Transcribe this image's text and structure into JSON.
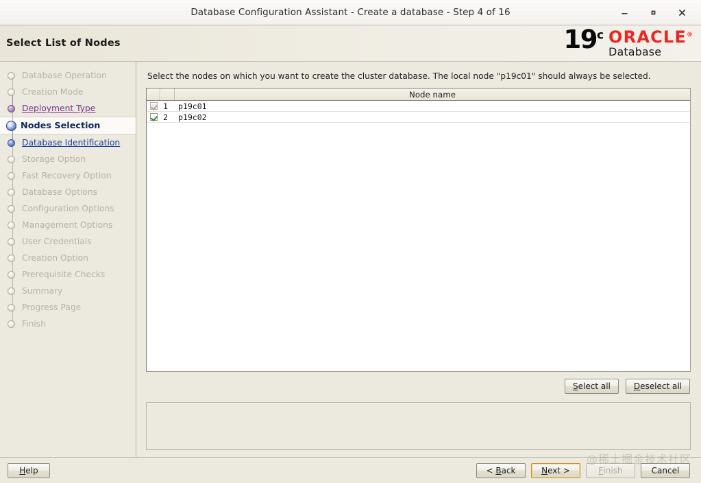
{
  "window": {
    "title": "Database Configuration Assistant - Create a database - Step 4 of 16",
    "controls": {
      "minimize": "minimize-icon",
      "maximize": "maximize-icon",
      "close": "close-icon"
    }
  },
  "header": {
    "page_title": "Select List of Nodes",
    "brand": {
      "version": "19",
      "version_sup": "c",
      "product": "ORACLE",
      "product_sup": "®",
      "subtitle": "Database",
      "oracle_red": "#ea2724"
    }
  },
  "sidebar": {
    "items": [
      {
        "label": "Database Operation",
        "state": "done"
      },
      {
        "label": "Creation Mode",
        "state": "done"
      },
      {
        "label": "Deployment Type",
        "state": "visited"
      },
      {
        "label": "Nodes Selection",
        "state": "current"
      },
      {
        "label": "Database Identification",
        "state": "link"
      },
      {
        "label": "Storage Option",
        "state": "done"
      },
      {
        "label": "Fast Recovery Option",
        "state": "done"
      },
      {
        "label": "Database Options",
        "state": "done"
      },
      {
        "label": "Configuration Options",
        "state": "done"
      },
      {
        "label": "Management Options",
        "state": "done"
      },
      {
        "label": "User Credentials",
        "state": "done"
      },
      {
        "label": "Creation Option",
        "state": "done"
      },
      {
        "label": "Prerequisite Checks",
        "state": "done"
      },
      {
        "label": "Summary",
        "state": "done"
      },
      {
        "label": "Progress Page",
        "state": "done"
      },
      {
        "label": "Finish",
        "state": "done"
      }
    ]
  },
  "main": {
    "instruction": "Select the nodes on which you want to create the cluster database. The local node \"p19c01\" should always be selected.",
    "table": {
      "columns": [
        "",
        "",
        "Node name"
      ],
      "header_node_name": "Node name",
      "rows": [
        {
          "checked": true,
          "enabled": false,
          "num": "1",
          "name": "p19c01"
        },
        {
          "checked": true,
          "enabled": true,
          "num": "2",
          "name": "p19c02"
        }
      ]
    },
    "select_all_label": "Select all",
    "select_all_mnemonic": "S",
    "deselect_all_label": "Deselect all",
    "deselect_all_mnemonic": "D",
    "message_panel_text": ""
  },
  "footer": {
    "help_label": "Help",
    "help_mnemonic": "H",
    "back_label": "< Back",
    "back_mnemonic": "B",
    "next_label": "Next >",
    "next_mnemonic": "N",
    "finish_label": "Finish",
    "finish_mnemonic": "F",
    "cancel_label": "Cancel"
  },
  "watermark": {
    "text": "@稀土掘金技术社区"
  }
}
